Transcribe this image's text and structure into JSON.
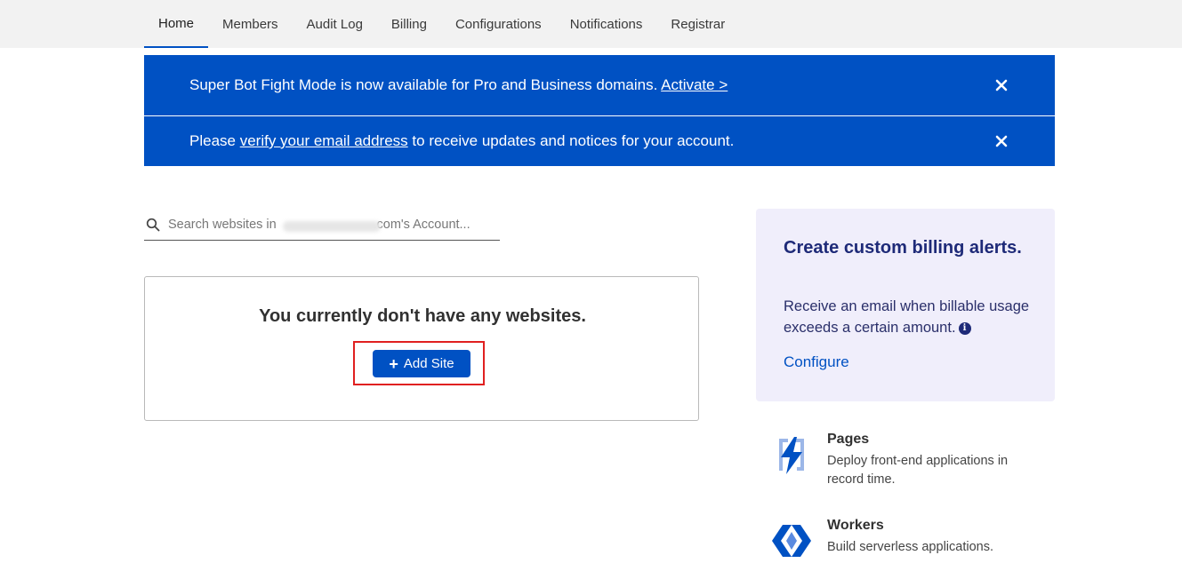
{
  "nav": {
    "tabs": [
      {
        "label": "Home",
        "active": true
      },
      {
        "label": "Members"
      },
      {
        "label": "Audit Log"
      },
      {
        "label": "Billing"
      },
      {
        "label": "Configurations"
      },
      {
        "label": "Notifications"
      },
      {
        "label": "Registrar"
      }
    ],
    "accent": "#0051c3"
  },
  "banners": {
    "bot_fight": {
      "text": "Super Bot Fight Mode is now available for Pro and Business domains.",
      "link": "Activate >"
    },
    "verify": {
      "before": "Please",
      "link": "verify your email address",
      "after": "to receive updates and notices for your account."
    },
    "background": "#0051c3"
  },
  "search": {
    "placeholder": "Search websites in                           .com's Account...",
    "value": ""
  },
  "empty_state": {
    "title": "You currently don't have any websites.",
    "button_label": "Add Site",
    "highlight_color": "#e02020"
  },
  "billing_card": {
    "title": "Create custom billing alerts.",
    "description": "Receive an email when billable usage exceeds a certain amount.",
    "link": "Configure",
    "background": "#f0eefb"
  },
  "products": [
    {
      "name": "Pages",
      "description": "Deploy front-end applications in record time.",
      "icon": "pages-icon"
    },
    {
      "name": "Workers",
      "description": "Build serverless applications.",
      "icon": "workers-icon"
    }
  ]
}
